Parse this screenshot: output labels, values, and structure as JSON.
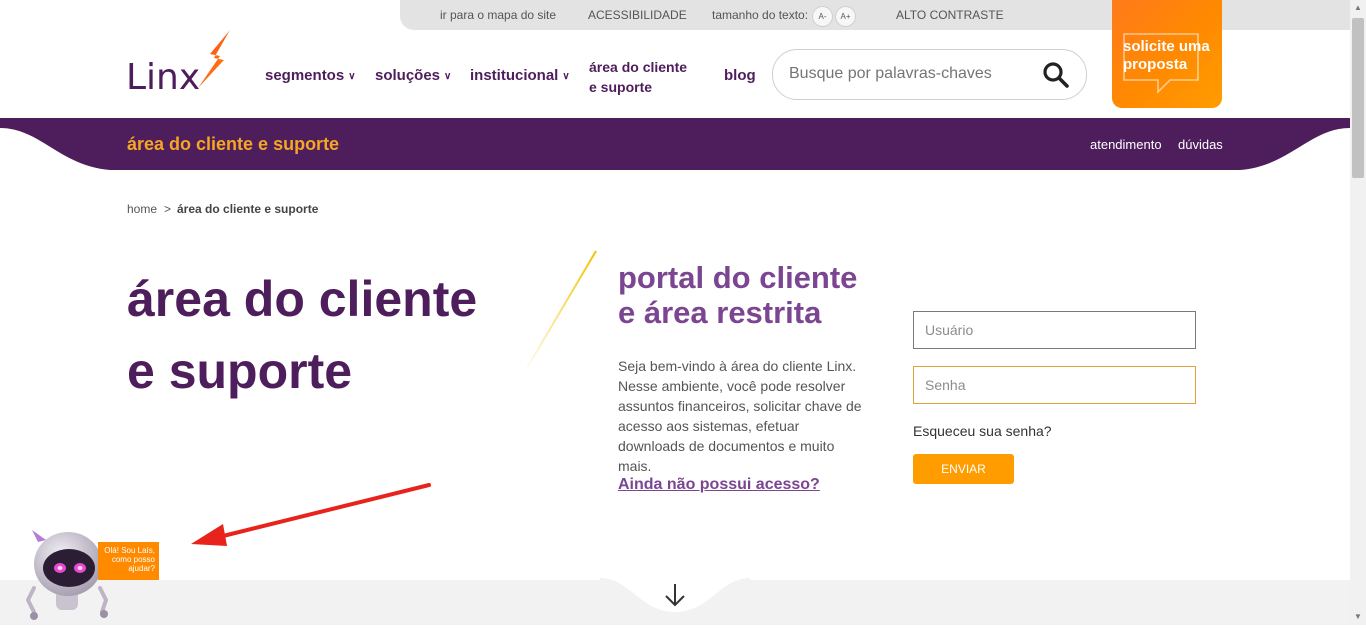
{
  "topbar": {
    "sitemap_link": "ir para o mapa do site",
    "accessibility_link": "ACESSIBILIDADE",
    "text_size_label": "tamanho do texto:",
    "font_decrease": "A-",
    "font_increase": "A+",
    "high_contrast_link": "ALTO CONTRASTE"
  },
  "header": {
    "logo_text": "Linx",
    "nav": {
      "segmentos": "segmentos",
      "solucoes": "soluções",
      "institucional": "institucional",
      "area_line1": "área do cliente",
      "area_line2": "e suporte",
      "blog": "blog"
    },
    "search_placeholder": "Busque por palavras-chaves",
    "cta_line1": "solicite uma",
    "cta_line2": "proposta"
  },
  "band": {
    "title": "área do cliente e suporte",
    "atendimento": "atendimento",
    "duvidas": "dúvidas"
  },
  "breadcrumb": {
    "home": "home",
    "separator": ">",
    "current": "área do cliente e suporte"
  },
  "hero": {
    "title_line1": "área do cliente",
    "title_line2": "e suporte",
    "portal_line1": "portal do cliente",
    "portal_line2": "e área restrita",
    "description": "Seja bem-vindo à área do cliente Linx. Nesse ambiente, você pode resolver assuntos financeiros, solicitar chave de acesso aos sistemas, efetuar downloads de documentos e muito mais.",
    "no_access_link": "Ainda não possui acesso?"
  },
  "login": {
    "user_placeholder": "Usuário",
    "password_placeholder": "Senha",
    "forgot_link": "Esqueceu sua senha?",
    "submit_label": "ENVIAR"
  },
  "chatbot": {
    "line1": "Olá! Sou Laís,",
    "line2": "como posso",
    "line3": "ajudar?"
  },
  "colors": {
    "brand_purple": "#4e1d5b",
    "accent_orange": "#ff8a00",
    "band_title": "#f5a623",
    "portal_purple": "#7b4592"
  }
}
